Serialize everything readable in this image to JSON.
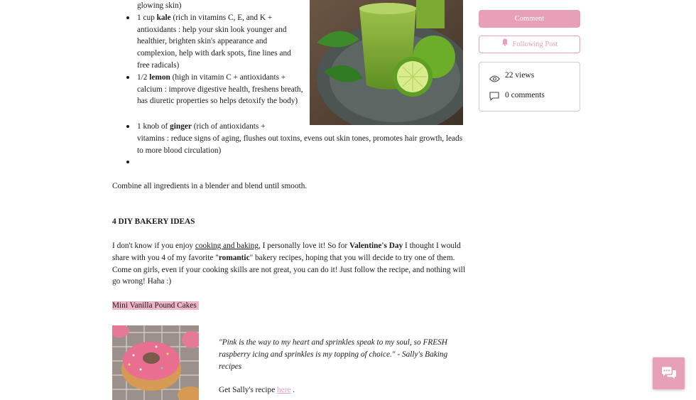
{
  "article": {
    "bullet0_tail": "glowing skin)",
    "kale": {
      "pre": "1 cup ",
      "bold": "kale",
      "rest": " (rich in vitamins C, E, and K + antioxidants : help your skin look younger and healthier, brighten skin's appearance and complexion, help with dark spots, fine lines and free radicals)"
    },
    "lemon": {
      "pre": "1/2 ",
      "bold": "lemon",
      "rest": " (high in vitamin C + antioxidants + calcium : improve digestive health, freshens breath, has diuretic properties so helps detoxify the body)"
    },
    "ginger": {
      "pre": "1 knob of ",
      "bold": "ginger",
      "rest_line1": " (rich of antioxidants +",
      "rest_line2": "vitamins : reduce signs of aging, flushes out toxins, evens out skin tones,  promotes hair growth, leads",
      "rest_line3": "to more blood circulation)"
    },
    "combine": "Combine all ingredients in a blender and blend until smooth.",
    "heading": "4 DIY BAKERY IDEAS",
    "intro": {
      "p1": "I don't know if you enjoy ",
      "link": "cooking and baking",
      "p2": ", I personally love it! So for ",
      "bold1": "Valentine's Day",
      "p3": " I thought I would",
      "line2_pre": "share with you 4 of my favorite \"",
      "bold2": "romantic",
      "line2_post": "\" bakery recipes, hoping that you will decide to try one of them.",
      "line3": "Come on girls, even if your cooking skills are not great, you can do it! Just follow the recipe, and nothing will",
      "line4": "go wrong! Haha :)"
    },
    "recipe_title": "Mini Vanilla Pound Cakes ",
    "quote": "\"Pink is the way to my heart and sprinkles speak to my soul, so FRESH raspberry icing and sprinkles is my topping of choice.\" - Sally's Baking recipes",
    "get_recipe": {
      "pre": "Get Sally's recipe ",
      "link": "here",
      "post": " ."
    }
  },
  "sidebar": {
    "comment_label": "Comment",
    "follow_label": "Following Post",
    "views": "22 views",
    "comments": "0 comments"
  },
  "colors": {
    "accent": "#e8a0b9",
    "highlight": "#efb6c8"
  },
  "icons": [
    "bell-icon",
    "eye-icon",
    "comment-icon",
    "chat-icon"
  ]
}
